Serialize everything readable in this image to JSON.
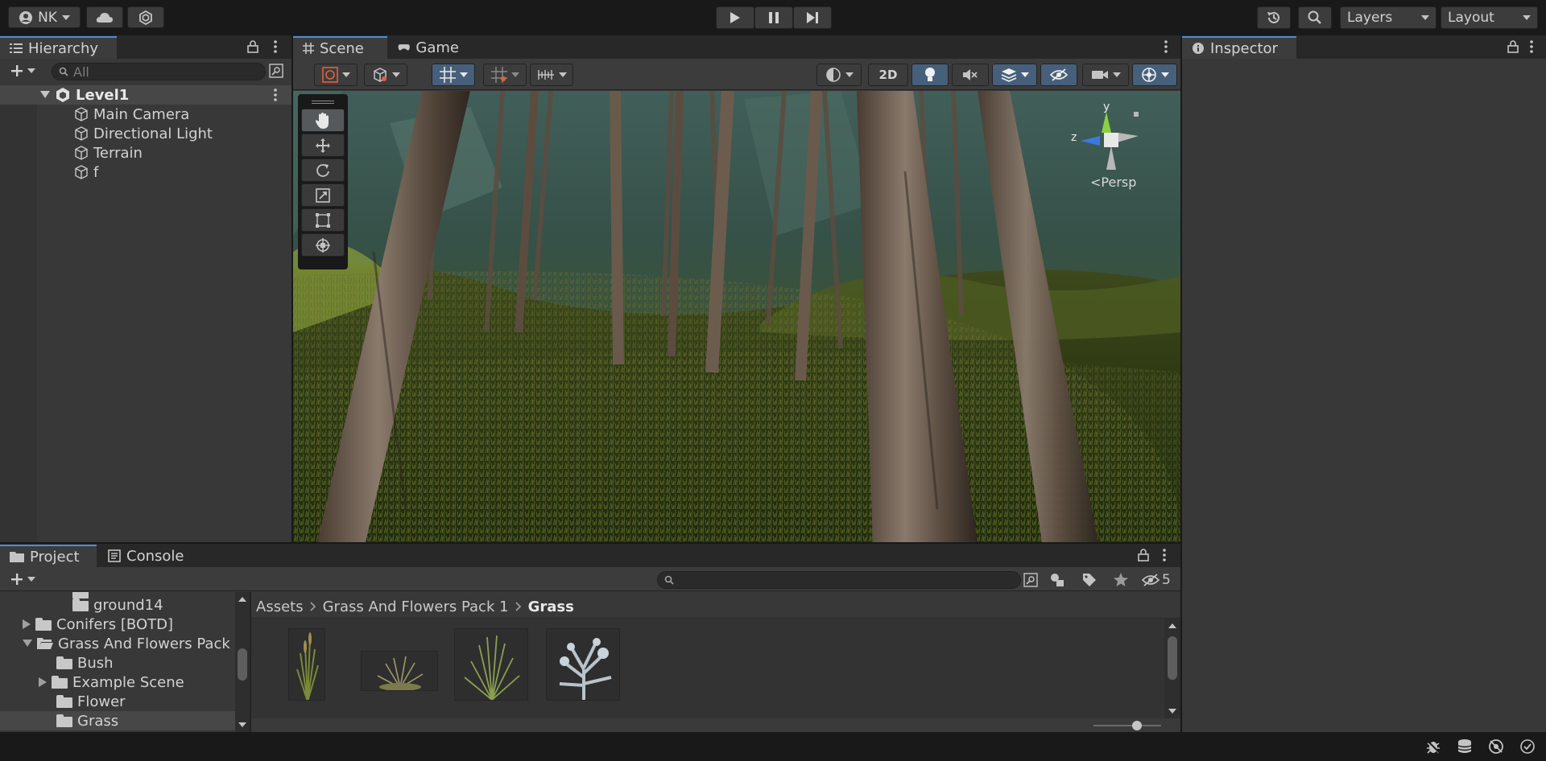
{
  "toolbar": {
    "account_label": "NK",
    "layers_label": "Layers",
    "layout_label": "Layout"
  },
  "hierarchy": {
    "tab_label": "Hierarchy",
    "search_placeholder": "All",
    "scene_name": "Level1",
    "items": [
      {
        "label": "Main Camera"
      },
      {
        "label": "Directional Light"
      },
      {
        "label": "Terrain"
      },
      {
        "label": "f"
      }
    ]
  },
  "scene": {
    "tabs": [
      {
        "label": "Scene"
      },
      {
        "label": "Game"
      }
    ],
    "two_d_label": "2D",
    "gizmo": {
      "y_label": "y",
      "z_label": "z",
      "persp_label": "<Persp"
    }
  },
  "inspector": {
    "tab_label": "Inspector"
  },
  "project": {
    "tabs": [
      {
        "label": "Project"
      },
      {
        "label": "Console"
      }
    ],
    "hidden_count": "5",
    "tree": [
      {
        "label": "ground14",
        "indent": 3
      },
      {
        "label": "Conifers [BOTD]",
        "indent": 1
      },
      {
        "label": "Grass And Flowers Pack",
        "indent": 1
      },
      {
        "label": "Bush",
        "indent": 2
      },
      {
        "label": "Example Scene",
        "indent": 2
      },
      {
        "label": "Flower",
        "indent": 2
      },
      {
        "label": "Grass",
        "indent": 2
      }
    ],
    "breadcrumb": [
      "Assets",
      "Grass And Flowers Pack 1",
      "Grass"
    ]
  },
  "colors": {
    "accent": "#4a8fd8",
    "selected_row": "#2c5d87",
    "panel": "#383838",
    "toolbar": "#191919"
  }
}
